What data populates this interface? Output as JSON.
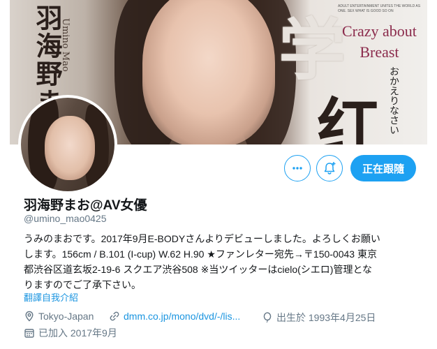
{
  "banner": {
    "vertical_title": "羽海野ま",
    "vertical_sub": "Umino Mao",
    "kanji_top": "学",
    "kanji_bottom": "红",
    "tagline_line1": "Crazy about",
    "tagline_line2": "Breast",
    "small_print": "ADULT ENTERTAINMENT UNITES THE WORLD AS ONE. SEX WHAT IS GOOD SO ON",
    "script_text": "おかえりなさい"
  },
  "profile": {
    "name": "羽海野まお@AV女優",
    "handle": "@umino_mao0425",
    "bio_lines": [
      "うみのまおです。2017年9月E-BODYさんよりデビューしました。よろしくお願い",
      "します。156cm / B.101 (I-cup) W.62 H.90 ★ファンレター宛先→〒150-0043 東京",
      "都渋谷区道玄坂2-19-6 スクエア渋谷508 ※当ツイッターはcielo(シエロ)管理とな",
      "りますのでご了承下さい。"
    ],
    "translate_label": "翻譯自我介紹",
    "location": "Tokyo-Japan",
    "website": "dmm.co.jp/mono/dvd/-/lis...",
    "birthday": "出生於 1993年4月25日",
    "joined": "已加入 2017年9月"
  },
  "actions": {
    "follow_label": "正在跟隨"
  },
  "colors": {
    "accent": "#1da1f2",
    "link": "#1b95e0",
    "muted": "#657786"
  }
}
